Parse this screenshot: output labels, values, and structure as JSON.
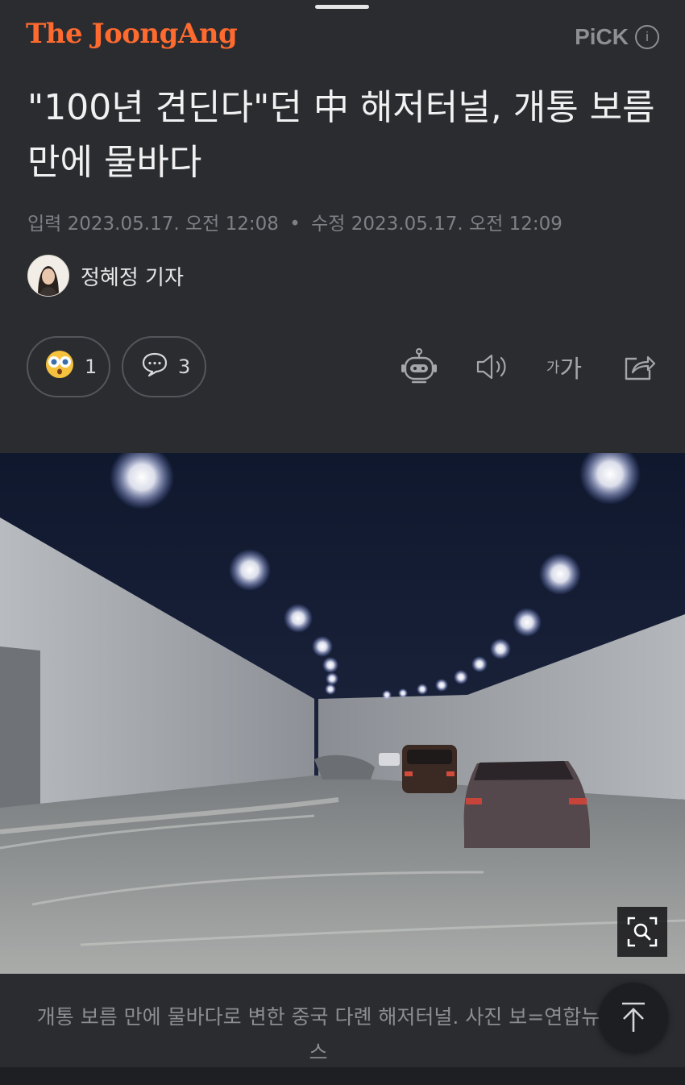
{
  "header": {
    "brand": "The JoongAng",
    "pick_label": "PiCK",
    "info_glyph": "i"
  },
  "article": {
    "title": "\"100년 견딘다\"던 中 해저터널, 개통 보름 만에 물바다",
    "dates": {
      "input_label": "입력",
      "input_value": "2023.05.17. 오전 12:08",
      "separator": "•",
      "modified_label": "수정",
      "modified_value": "2023.05.17. 오전 12:09"
    },
    "author": "정혜정 기자",
    "reactions": {
      "count": "1",
      "icon": "surprised-face-icon"
    },
    "comments": {
      "count": "3",
      "icon": "speech-bubble-icon"
    },
    "tools": {
      "summary_icon": "robot-icon",
      "tts_icon": "speaker-icon",
      "text_size_small": "가",
      "text_size_large": "가",
      "share_icon": "share-icon"
    },
    "photo": {
      "caption": "개통 보름 만에 물바다로 변한 중국 다롄 해저터널. 사진 보=연합뉴스",
      "zoom_icon": "zoom-search-icon"
    }
  },
  "scroll_top_icon": "arrow-up-icon",
  "colors": {
    "background": "#2b2c30",
    "brand": "#ff6a2f",
    "muted": "#7f8085"
  }
}
